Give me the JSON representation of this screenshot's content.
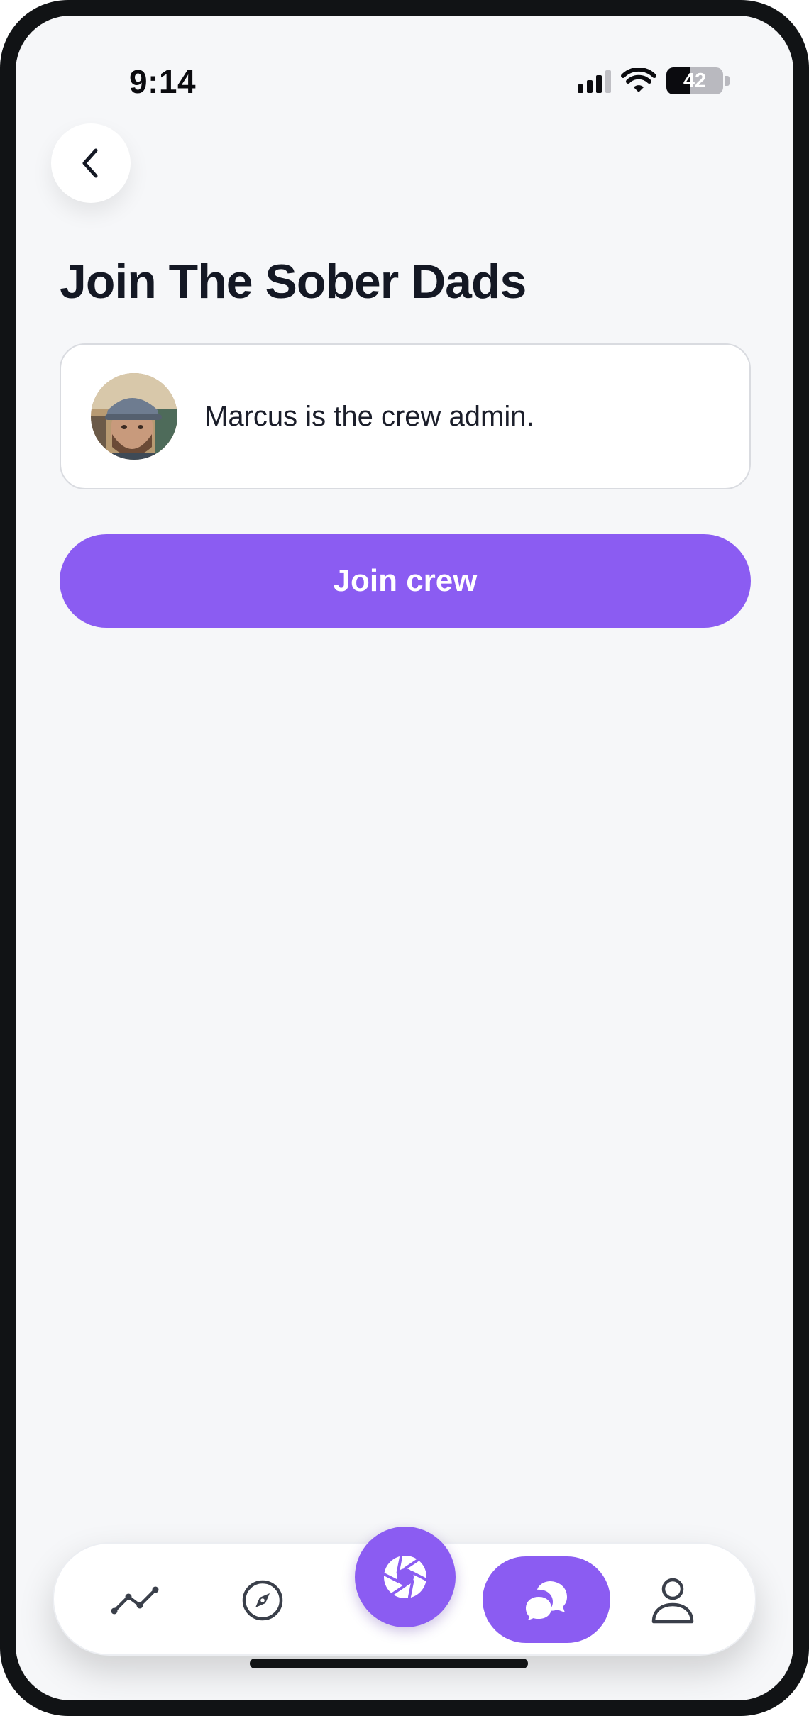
{
  "status_bar": {
    "time": "9:14",
    "battery": "42",
    "battery_level": 0.42
  },
  "header": {
    "back_icon": "chevron-left-icon",
    "title": "Join The Sober Dads"
  },
  "admin_card": {
    "avatar_icon": "avatar",
    "text": "Marcus is the crew admin."
  },
  "join_button": {
    "label": "Join crew"
  },
  "bottom_nav": {
    "items": [
      {
        "icon": "activity-chart-icon",
        "active": false
      },
      {
        "icon": "compass-icon",
        "active": false
      },
      {
        "icon": "camera-aperture-icon",
        "active": false
      },
      {
        "icon": "chat-bubbles-icon",
        "active": true
      },
      {
        "icon": "profile-icon",
        "active": false
      }
    ]
  },
  "colors": {
    "accent": "#8b5cf2",
    "background": "#f6f7f9",
    "title": "#141824"
  }
}
